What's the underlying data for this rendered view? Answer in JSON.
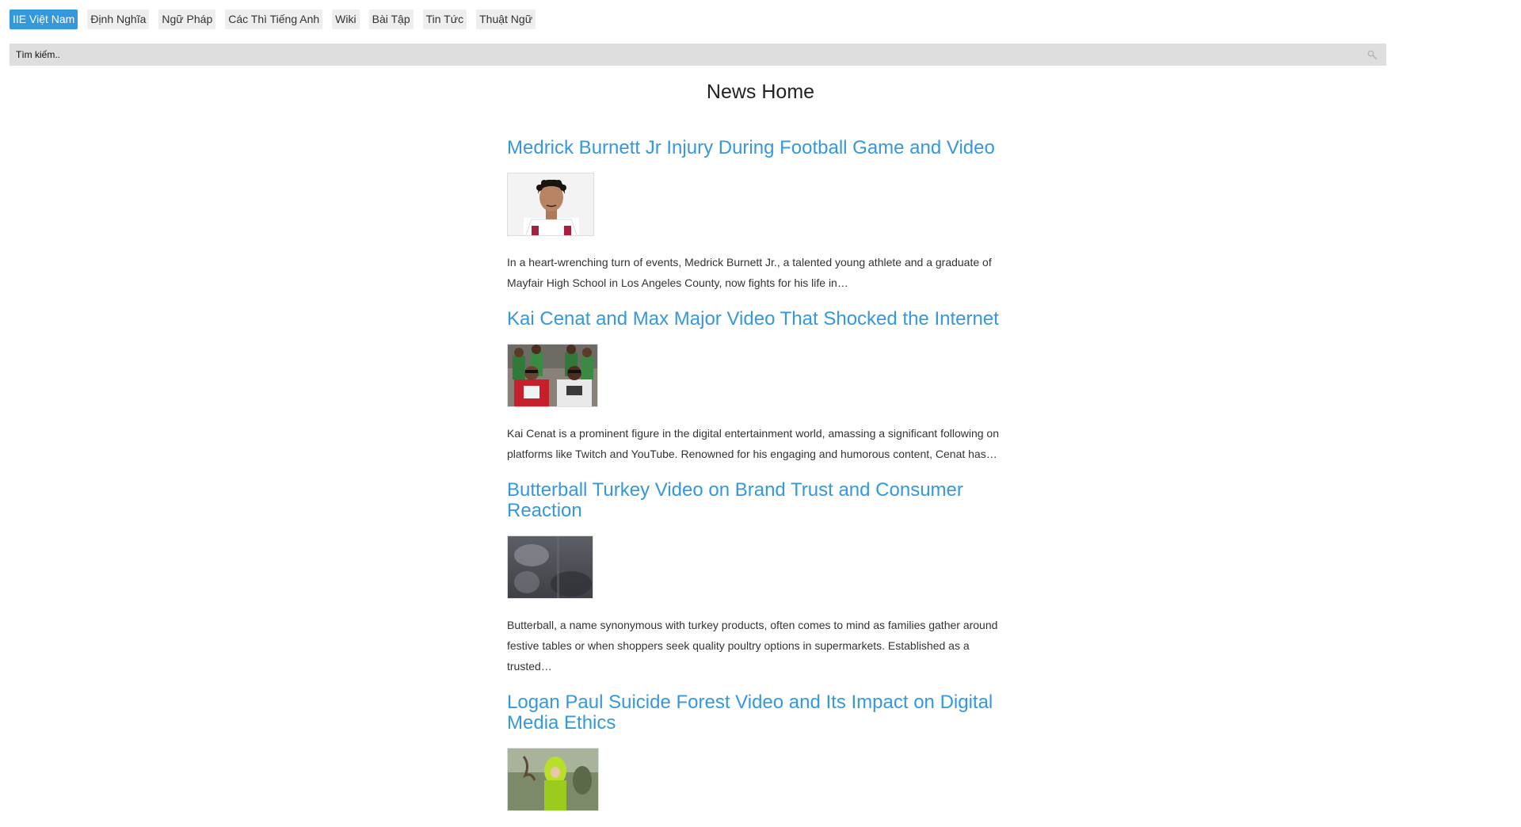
{
  "nav": {
    "items": [
      {
        "label": "IIE Việt Nam"
      },
      {
        "label": "Định Nghĩa"
      },
      {
        "label": "Ngữ Pháp"
      },
      {
        "label": "Các Thì Tiếng Anh"
      },
      {
        "label": "Wiki"
      },
      {
        "label": "Bài Tập"
      },
      {
        "label": "Tin Tức"
      },
      {
        "label": "Thuật Ngữ"
      }
    ],
    "active_color": "#3498db"
  },
  "search": {
    "placeholder": "Tìm kiếm..",
    "icon": "search-icon"
  },
  "page": {
    "title": "News Home"
  },
  "articles": [
    {
      "title": "Medrick Burnett Jr Injury During Football Game and Video",
      "excerpt": "In a heart-wrenching turn of events, Medrick Burnett Jr., a talented young athlete and a graduate of Mayfair High School in Los Angeles County, now fights for his life in…"
    },
    {
      "title": "Kai Cenat and Max Major Video That Shocked the Internet",
      "excerpt": "Kai Cenat is a prominent figure in the digital entertainment world, amassing a significant following on platforms like Twitch and YouTube. Renowned for his engaging and humorous content, Cenat has…"
    },
    {
      "title": "Butterball Turkey Video on Brand Trust and Consumer Reaction",
      "excerpt": "Butterball, a name synonymous with turkey products, often comes to mind as families gather around festive tables or when shoppers seek quality poultry options in supermarkets. Established as a trusted…"
    },
    {
      "title": "Logan Paul Suicide Forest Video and Its Impact on Digital Media Ethics",
      "excerpt": ""
    }
  ],
  "colors": {
    "link": "#3498db",
    "search_bg": "#dedede",
    "nav_bg": "#eeeeee"
  }
}
